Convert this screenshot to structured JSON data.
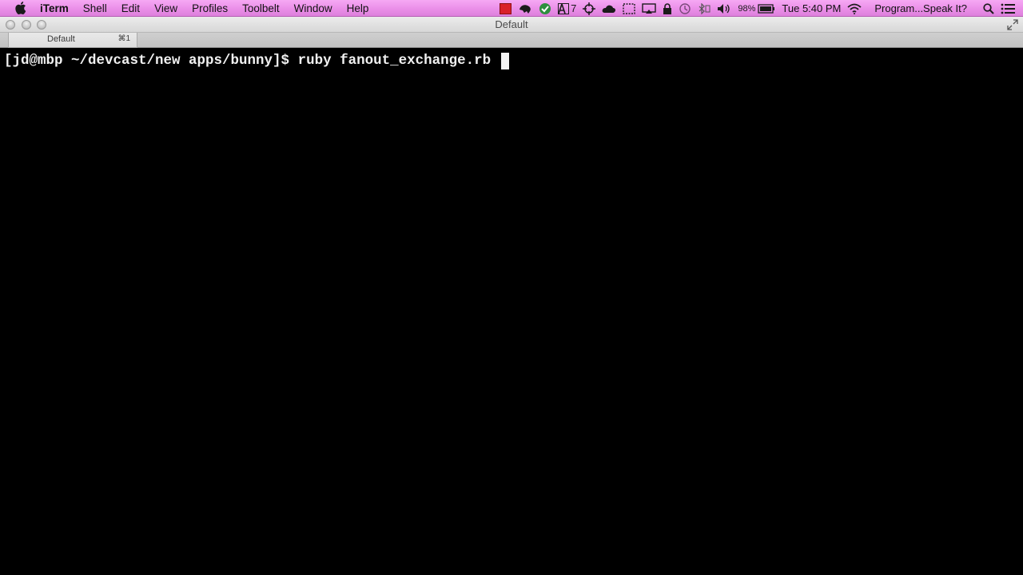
{
  "menubar": {
    "app_name": "iTerm",
    "items": [
      "Shell",
      "Edit",
      "View",
      "Profiles",
      "Toolbelt",
      "Window",
      "Help"
    ],
    "status": {
      "mail_count": "7",
      "battery": "98%",
      "clock": "Tue 5:40 PM",
      "now_playing": "Program...Speak It?"
    }
  },
  "window": {
    "title": "Default"
  },
  "tabs": [
    {
      "label": "Default",
      "shortcut": "⌘1"
    }
  ],
  "terminal": {
    "prompt": "[jd@mbp ~/devcast/new apps/bunny]$ ",
    "command": "ruby fanout_exchange.rb "
  },
  "colors": {
    "menubar": "#ea8fe8",
    "terminal_bg": "#000000",
    "terminal_fg": "#f0f0f0"
  }
}
